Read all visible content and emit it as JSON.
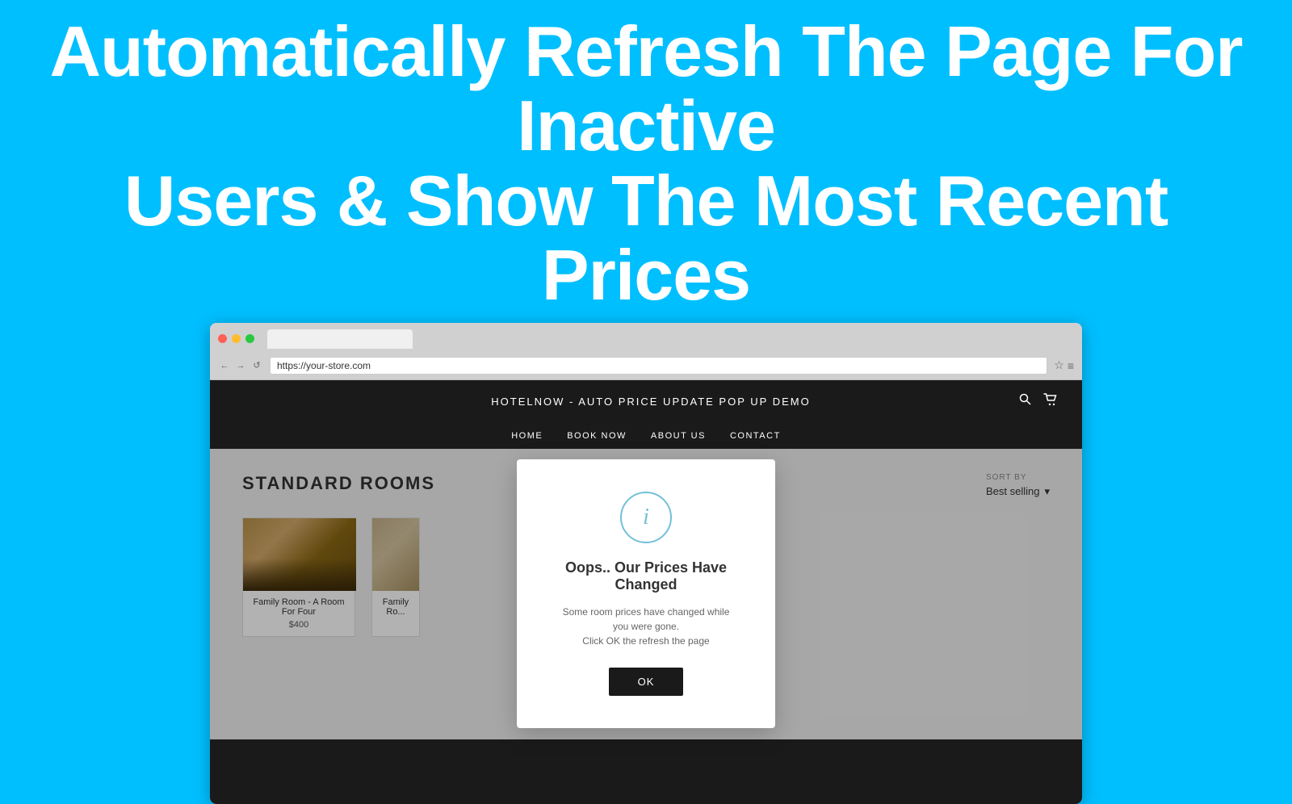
{
  "hero": {
    "title_line1": "Automatically Refresh The Page For Inactive",
    "title_line2": "Users & Show The Most Recent Prices"
  },
  "browser": {
    "url": "https://your-store.com",
    "dots": [
      "red",
      "yellow",
      "green"
    ],
    "nav_back": "←",
    "nav_forward": "→",
    "nav_refresh": "↺",
    "star_icon": "☆",
    "menu_icon": "≡"
  },
  "store": {
    "title": "HOTELNOW - AUTO PRICE UPDATE POP UP DEMO",
    "nav": [
      "HOME",
      "BOOK NOW",
      "ABOUT US",
      "CONTACT"
    ],
    "search_icon": "🔍",
    "cart_icon": "🛒"
  },
  "collection": {
    "title": "STANDARD ROOMS",
    "sort_label": "SORT BY",
    "sort_value": "Best selling",
    "sort_arrow": "▾"
  },
  "products": [
    {
      "name": "Family Room - A Room For Four",
      "price": "$400",
      "img_class": "room-img-1"
    },
    {
      "name": "Family Ro...",
      "price": "...",
      "img_class": "room-img-2"
    }
  ],
  "modal": {
    "icon_letter": "i",
    "title": "Oops.. Our Prices Have Changed",
    "body_line1": "Some room prices have changed while you were gone.",
    "body_line2": "Click OK the refresh the page",
    "ok_button": "OK"
  }
}
